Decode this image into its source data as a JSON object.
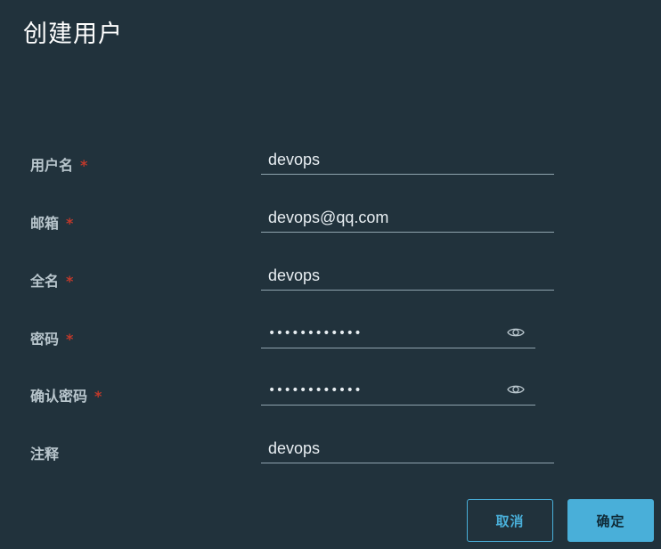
{
  "dialog": {
    "title": "创建用户"
  },
  "fields": [
    {
      "label": "用户名",
      "required": "*",
      "value": "devops"
    },
    {
      "label": "邮箱",
      "required": "*",
      "value": "devops@qq.com"
    },
    {
      "label": "全名",
      "required": "*",
      "value": "devops"
    },
    {
      "label": "密码",
      "required": "*",
      "value": "••••••••••••"
    },
    {
      "label": "确认密码",
      "required": "*",
      "value": "••••••••••••"
    },
    {
      "label": "注释",
      "required": "",
      "value": "devops"
    }
  ],
  "icons": {
    "password_toggle": "eye-icon"
  },
  "buttons": {
    "cancel_label": "取消",
    "ok_label": "确定"
  },
  "colors": {
    "background": "#21323c",
    "accent": "#49afd9",
    "required": "#c0392b"
  }
}
